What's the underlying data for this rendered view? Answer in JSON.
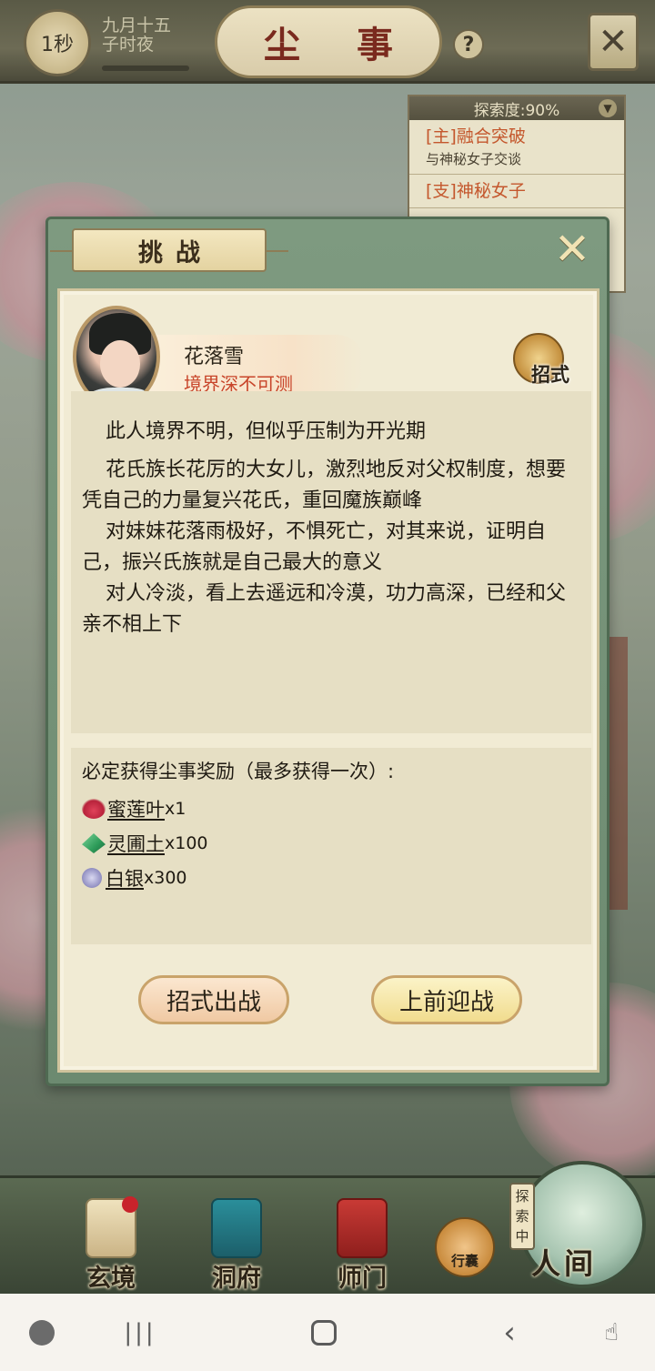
{
  "status": {
    "timer": "1秒",
    "date_line1": "九月十五",
    "date_line2": "子时夜"
  },
  "header": {
    "title": "尘 事",
    "help": "?",
    "close": "✕"
  },
  "quest_panel": {
    "header": "探索度:90%",
    "items": [
      {
        "title": "[主]融合突破",
        "desc": "与神秘女子交谈"
      },
      {
        "title": "[支]神秘女子",
        "desc": ""
      }
    ]
  },
  "dialog": {
    "tab_title": "挑战",
    "close": "✕",
    "npc": {
      "name": "花落雪",
      "realm": "境界深不可测"
    },
    "skill_badge": "招式",
    "description": [
      "此人境界不明，但似乎压制为开光期",
      "花氏族长花厉的大女儿，激烈地反对父权制度，想要凭自己的力量复兴花氏，重回魔族巅峰",
      "对妹妹花落雨极好，不惧死亡，对其来说，证明自己，振兴氏族就是自己最大的意义",
      "对人冷淡，看上去遥远和冷漠，功力高深，已经和父亲不相上下"
    ],
    "rewards": {
      "title": "必定获得尘事奖励（最多获得一次）:",
      "items": [
        {
          "icon": "lotus-leaf-icon",
          "name": "蜜莲叶",
          "qty": "x1"
        },
        {
          "icon": "spirit-soil-icon",
          "name": "灵圃土",
          "qty": "x100"
        },
        {
          "icon": "silver-coin-icon",
          "name": "白银",
          "qty": "x300"
        }
      ]
    },
    "buttons": {
      "skill_battle": "招式出战",
      "fight": "上前迎战"
    }
  },
  "bottom_nav": {
    "items": [
      {
        "label": "玄境",
        "icon": "scroll-icon"
      },
      {
        "label": "洞府",
        "icon": "pavilion-icon"
      },
      {
        "label": "师门",
        "icon": "banner-icon"
      }
    ],
    "bag": "行囊",
    "explore_tag": "探索中",
    "world": "人间"
  },
  "system_nav": {
    "game": "game-launcher-icon",
    "recent": "|||",
    "home": "home-icon",
    "back": "‹",
    "touch": "touch-lock-icon"
  }
}
